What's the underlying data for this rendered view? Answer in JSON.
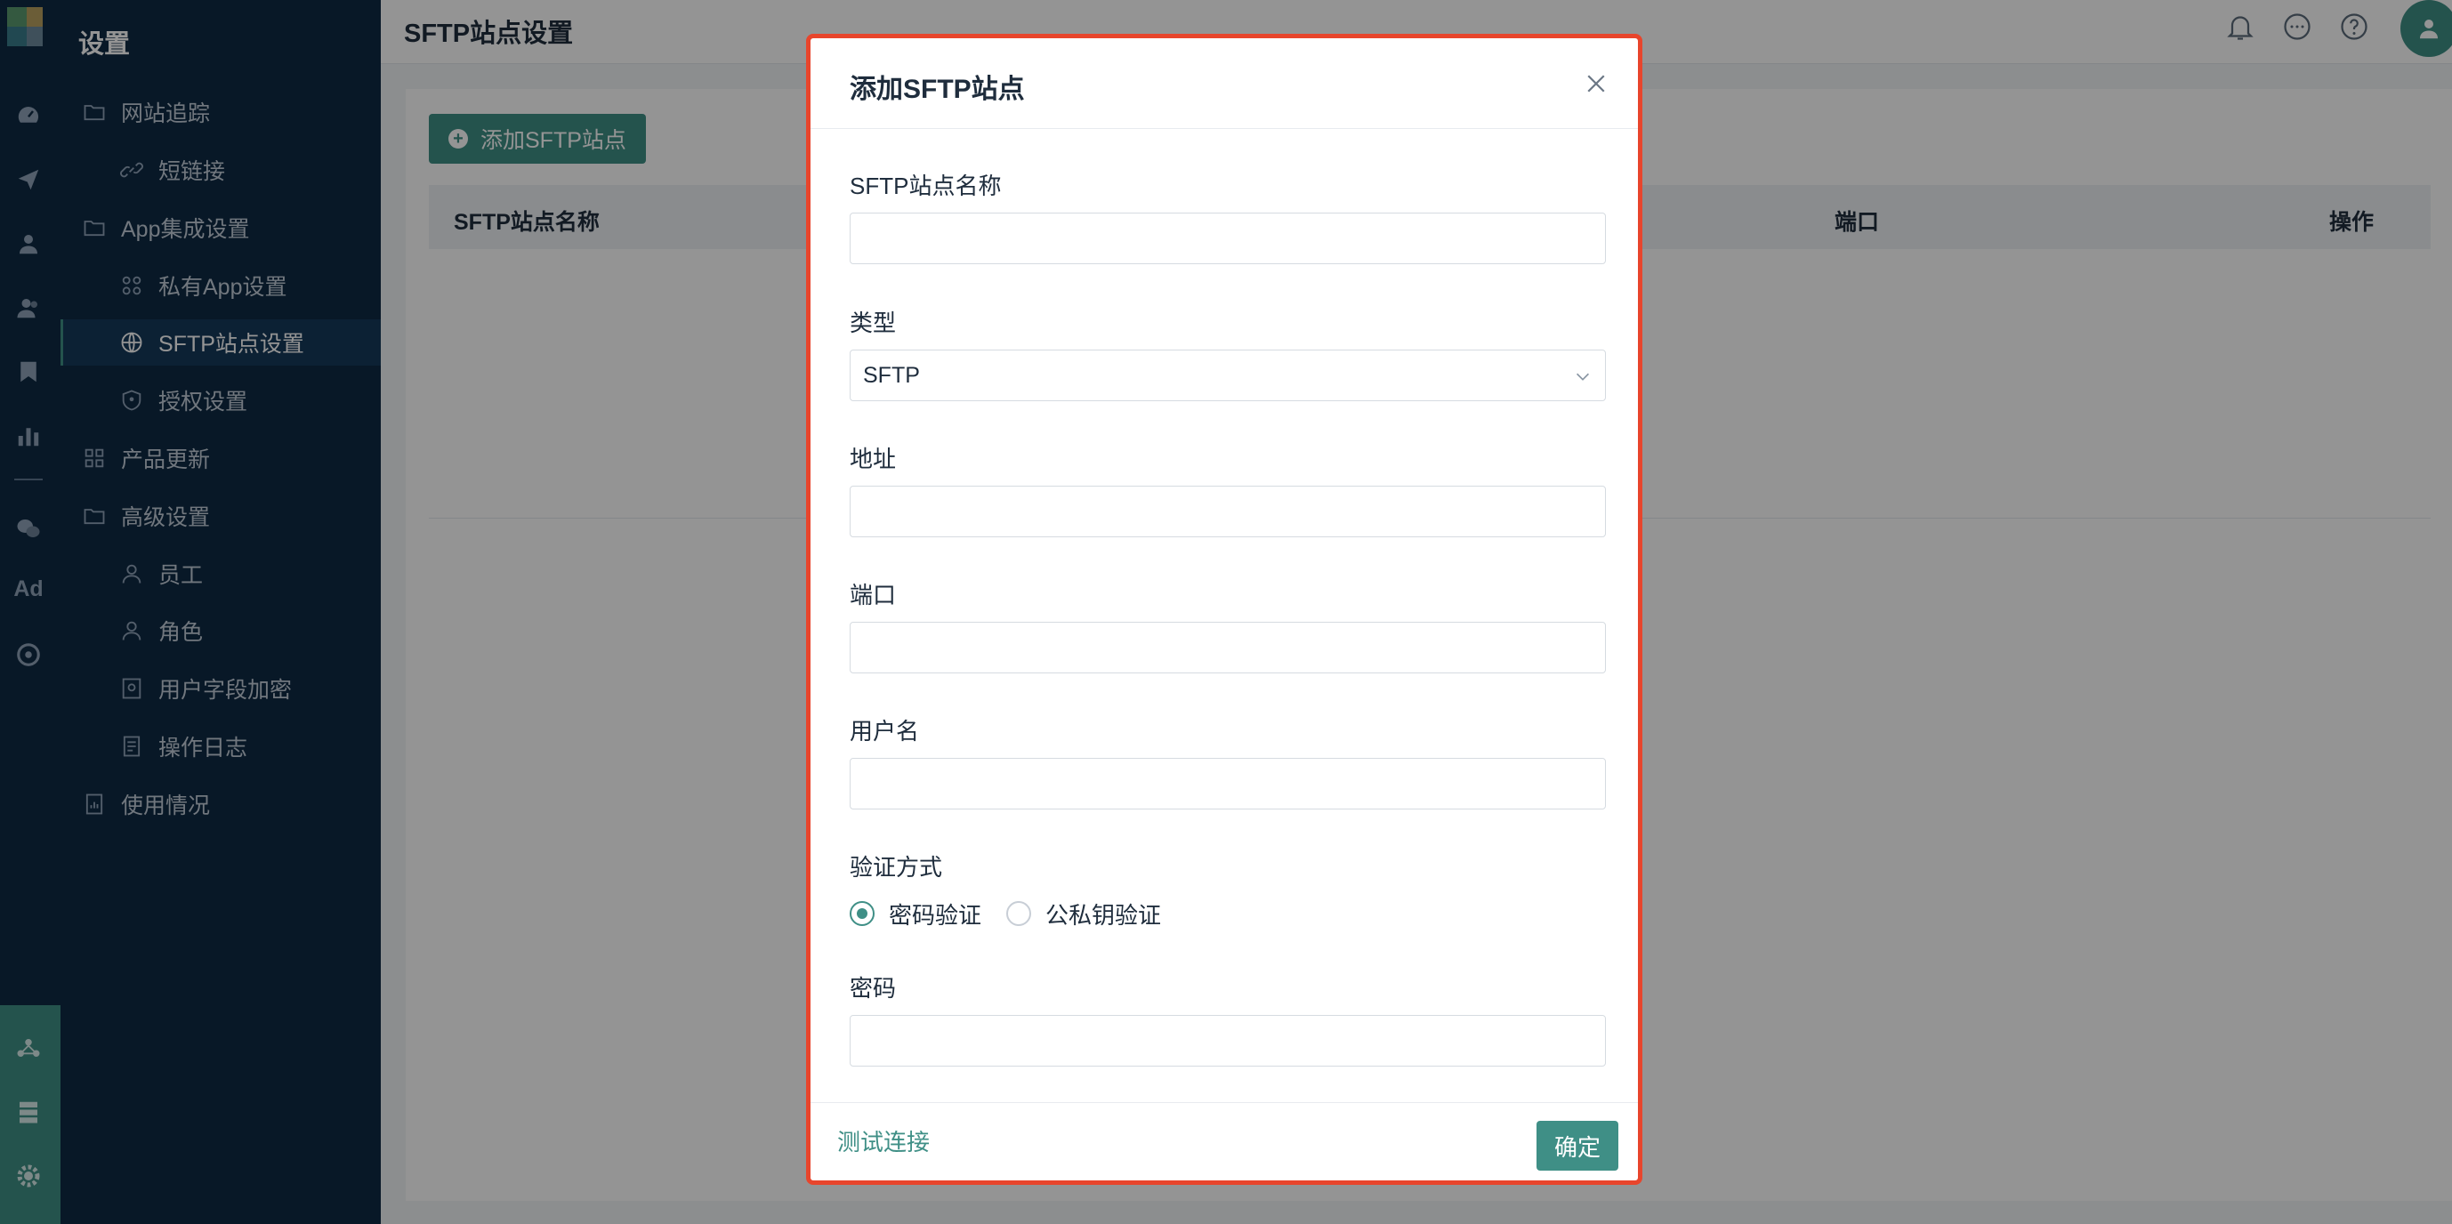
{
  "colors": {
    "accent": "#3f8f86",
    "sidebar_bg": "#0e2a44",
    "highlight_border": "#e8452c"
  },
  "rail": {
    "icons": [
      "dashboard-icon",
      "send-icon",
      "user-icon",
      "users-icon",
      "bookmark-icon",
      "bar-chart-icon",
      "wechat-icon",
      "ad-icon",
      "music-icon",
      "network-icon",
      "server-icon",
      "settings-icon"
    ],
    "ad_label": "Ad"
  },
  "sidebar": {
    "title": "设置",
    "items": [
      {
        "label": "网站追踪",
        "icon": "folder-icon",
        "level": 1
      },
      {
        "label": "短链接",
        "icon": "link-icon",
        "level": 2
      },
      {
        "label": "App集成设置",
        "icon": "folder-icon",
        "level": 1
      },
      {
        "label": "私有App设置",
        "icon": "apps-icon",
        "level": 2
      },
      {
        "label": "SFTP站点设置",
        "icon": "globe-icon",
        "level": 2,
        "active": true
      },
      {
        "label": "授权设置",
        "icon": "shield-icon",
        "level": 2
      },
      {
        "label": "产品更新",
        "icon": "grid-icon",
        "level": 1
      },
      {
        "label": "高级设置",
        "icon": "folder-icon",
        "level": 1
      },
      {
        "label": "员工",
        "icon": "person-icon",
        "level": 2
      },
      {
        "label": "角色",
        "icon": "person-icon",
        "level": 2
      },
      {
        "label": "用户字段加密",
        "icon": "encrypt-icon",
        "level": 2
      },
      {
        "label": "操作日志",
        "icon": "log-icon",
        "level": 2
      },
      {
        "label": "使用情况",
        "icon": "usage-icon",
        "level": 1
      }
    ]
  },
  "header": {
    "title": "SFTP站点设置",
    "icons": [
      "bell-icon",
      "message-icon",
      "help-icon",
      "avatar-icon"
    ]
  },
  "main": {
    "add_button": "添加SFTP站点",
    "table_headers": [
      "SFTP站点名称",
      "端口",
      "操作"
    ]
  },
  "modal": {
    "title": "添加SFTP站点",
    "fields": {
      "name": {
        "label": "SFTP站点名称",
        "value": ""
      },
      "type": {
        "label": "类型",
        "value": "SFTP"
      },
      "address": {
        "label": "地址",
        "value": ""
      },
      "port": {
        "label": "端口",
        "value": ""
      },
      "username": {
        "label": "用户名",
        "value": ""
      },
      "auth": {
        "label": "验证方式",
        "options": [
          "密码验证",
          "公私钥验证"
        ],
        "selected": "密码验证"
      },
      "password": {
        "label": "密码",
        "value": ""
      }
    },
    "test_link": "测试连接",
    "confirm": "确定"
  }
}
